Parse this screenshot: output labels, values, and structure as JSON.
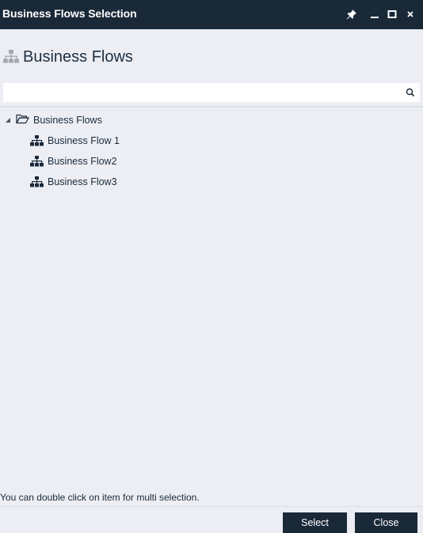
{
  "window": {
    "title": "Business Flows Selection"
  },
  "header": {
    "title": "Business Flows",
    "icon": "hierarchy-icon"
  },
  "search": {
    "value": "",
    "placeholder": ""
  },
  "tree": {
    "root": {
      "label": "Business Flows",
      "expanded": true,
      "icon": "folder-open-icon"
    },
    "children": [
      {
        "label": "Business Flow 1",
        "icon": "hierarchy-icon"
      },
      {
        "label": "Business Flow2",
        "icon": "hierarchy-icon"
      },
      {
        "label": "Business Flow3",
        "icon": "hierarchy-icon"
      }
    ]
  },
  "footer": {
    "hint": "You can double click on item for multi selection.",
    "select_label": "Select",
    "close_label": "Close"
  },
  "colors": {
    "titlebar": "#1a2938",
    "background": "#eceef4",
    "button": "#1a2938"
  }
}
